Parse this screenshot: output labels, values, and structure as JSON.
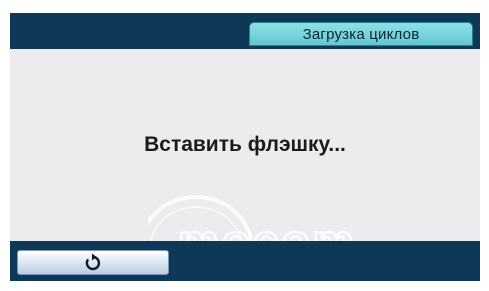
{
  "window": {
    "title": "Загрузка циклов"
  },
  "main": {
    "message": "Вставить флэшку..."
  },
  "footer": {
    "back_button_icon": "refresh-icon"
  },
  "watermark": {
    "text": "mocom"
  },
  "colors": {
    "frame": "#0e3858",
    "tab": "#63c7d2",
    "panel": "#ececee",
    "text": "#1b1b1b"
  }
}
